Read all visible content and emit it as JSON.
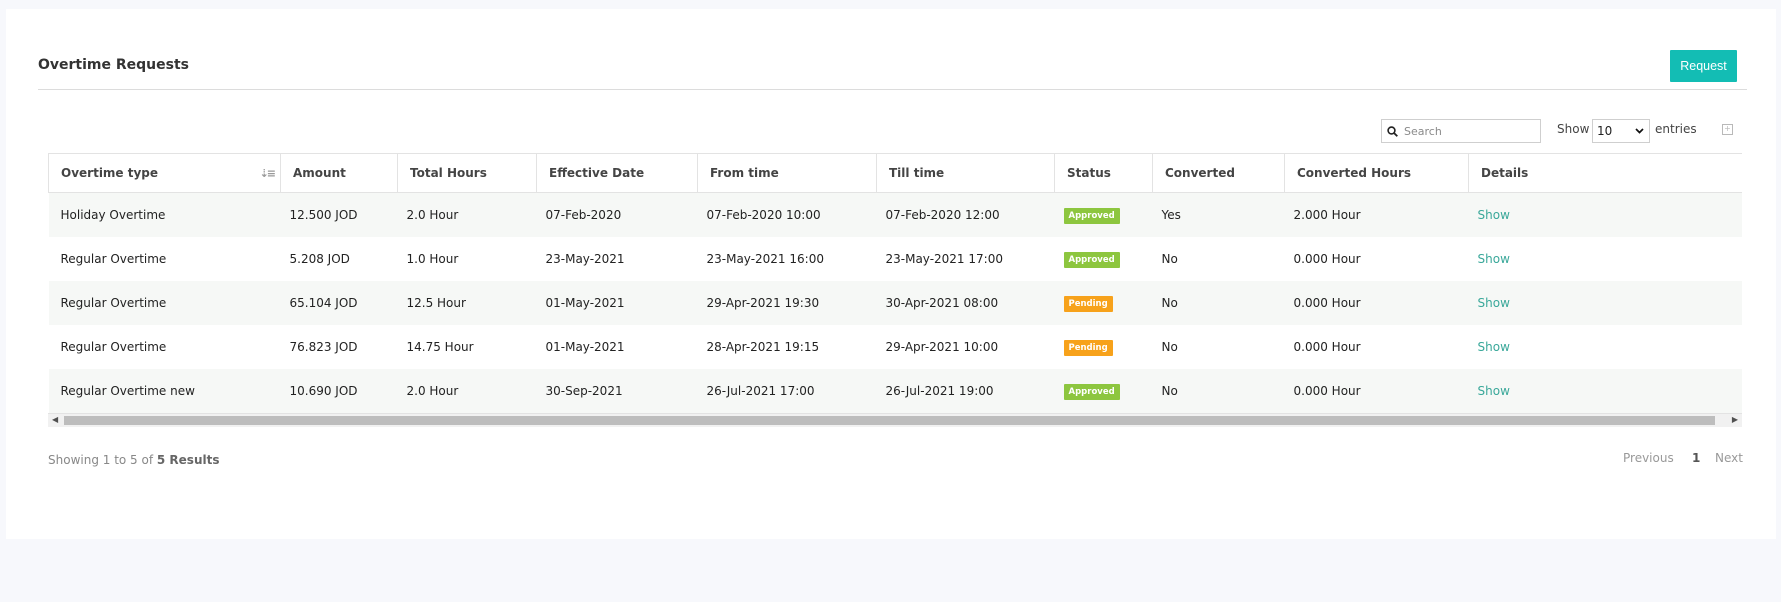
{
  "header": {
    "title": "Overtime Requests",
    "request_label": "Request"
  },
  "controls": {
    "search_placeholder": "Search",
    "show_label": "Show",
    "entries_value": "10",
    "entries_label": "entries"
  },
  "table": {
    "columns": [
      "Overtime type",
      "Amount",
      "Total Hours",
      "Effective Date",
      "From time",
      "Till time",
      "Status",
      "Converted",
      "Converted Hours",
      "Details"
    ],
    "rows": [
      {
        "type": "Holiday Overtime",
        "amount": "12.500 JOD",
        "hours": "2.0 Hour",
        "effective": "07-Feb-2020",
        "from": "07-Feb-2020 10:00",
        "till": "07-Feb-2020 12:00",
        "status": "Approved",
        "status_key": "approved",
        "converted": "Yes",
        "converted_hours": "2.000 Hour",
        "details": "Show"
      },
      {
        "type": "Regular Overtime",
        "amount": "5.208 JOD",
        "hours": "1.0 Hour",
        "effective": "23-May-2021",
        "from": "23-May-2021 16:00",
        "till": "23-May-2021 17:00",
        "status": "Approved",
        "status_key": "approved",
        "converted": "No",
        "converted_hours": "0.000 Hour",
        "details": "Show"
      },
      {
        "type": "Regular Overtime",
        "amount": "65.104 JOD",
        "hours": "12.5 Hour",
        "effective": "01-May-2021",
        "from": "29-Apr-2021 19:30",
        "till": "30-Apr-2021 08:00",
        "status": "Pending",
        "status_key": "pending",
        "converted": "No",
        "converted_hours": "0.000 Hour",
        "details": "Show"
      },
      {
        "type": "Regular Overtime",
        "amount": "76.823 JOD",
        "hours": "14.75 Hour",
        "effective": "01-May-2021",
        "from": "28-Apr-2021 19:15",
        "till": "29-Apr-2021 10:00",
        "status": "Pending",
        "status_key": "pending",
        "converted": "No",
        "converted_hours": "0.000 Hour",
        "details": "Show"
      },
      {
        "type": "Regular Overtime new",
        "amount": "10.690 JOD",
        "hours": "2.0 Hour",
        "effective": "30-Sep-2021",
        "from": "26-Jul-2021 17:00",
        "till": "26-Jul-2021 19:00",
        "status": "Approved",
        "status_key": "approved",
        "converted": "No",
        "converted_hours": "0.000 Hour",
        "details": "Show"
      }
    ]
  },
  "footer": {
    "summary_prefix": "Showing 1 to 5 of ",
    "summary_total": "5 Results",
    "previous": "Previous",
    "page": "1",
    "next": "Next"
  },
  "colors": {
    "accent": "#13bdb4",
    "approved": "#8dc63f",
    "pending": "#f7a21b",
    "link": "#3aa89a"
  },
  "icons": [
    "search-icon",
    "sort-icon",
    "chevron-down-icon",
    "export-icon",
    "chevron-left-icon",
    "chevron-right-icon"
  ]
}
